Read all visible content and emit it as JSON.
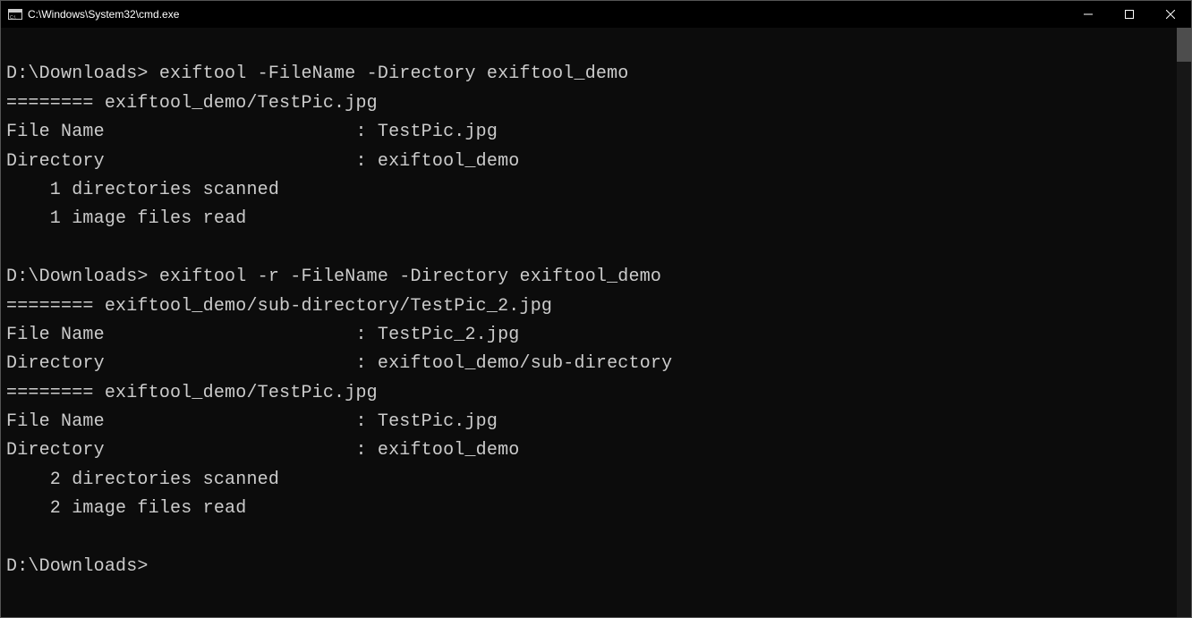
{
  "titlebar": {
    "title": "C:\\Windows\\System32\\cmd.exe"
  },
  "terminal": {
    "lines": [
      "",
      "D:\\Downloads> exiftool -FileName -Directory exiftool_demo",
      "======== exiftool_demo/TestPic.jpg",
      "File Name                       : TestPic.jpg",
      "Directory                       : exiftool_demo",
      "    1 directories scanned",
      "    1 image files read",
      "",
      "D:\\Downloads> exiftool -r -FileName -Directory exiftool_demo",
      "======== exiftool_demo/sub-directory/TestPic_2.jpg",
      "File Name                       : TestPic_2.jpg",
      "Directory                       : exiftool_demo/sub-directory",
      "======== exiftool_demo/TestPic.jpg",
      "File Name                       : TestPic.jpg",
      "Directory                       : exiftool_demo",
      "    2 directories scanned",
      "    2 image files read",
      "",
      "D:\\Downloads>"
    ]
  }
}
